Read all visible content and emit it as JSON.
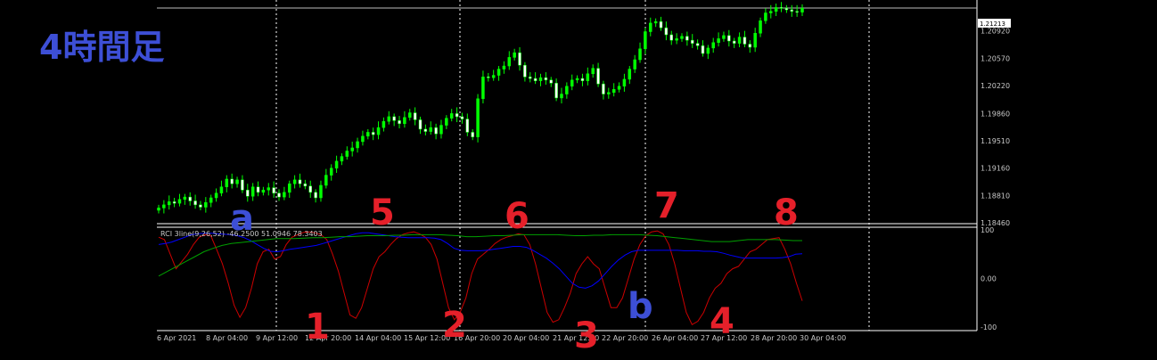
{
  "title": "4時間足",
  "indicator_label": "RCI 3line(9,26,52) -46.2500 51.0946 78.3403",
  "current_price": "1.21213",
  "colors": {
    "bull": "#00ff00",
    "bear": "#ffffff",
    "rci_short": "#cc0000",
    "rci_mid": "#0000ff",
    "rci_long": "#00a000",
    "annotation_red": "#e5202a",
    "annotation_blue": "#3d4fd6",
    "grid": "#ffffff"
  },
  "chart_data": [
    {
      "type": "candlestick",
      "title": "",
      "x_tick_labels": [
        "6 Apr 2021",
        "8 Apr 04:00",
        "9 Apr 12:00",
        "12 Apr 20:00",
        "14 Apr 04:00",
        "15 Apr 12:00",
        "16 Apr 20:00",
        "20 Apr 04:00",
        "21 Apr 12:00",
        "22 Apr 20:00",
        "26 Apr 04:00",
        "27 Apr 12:00",
        "28 Apr 20:00",
        "30 Apr 04:00"
      ],
      "y_tick_labels": [
        "1.20920",
        "1.20570",
        "1.20220",
        "1.19860",
        "1.19510",
        "1.19160",
        "1.18810",
        "1.18460"
      ],
      "y_ticks": [
        1.2092,
        1.2057,
        1.2022,
        1.1986,
        1.1951,
        1.1916,
        1.1881,
        1.1846
      ],
      "ylim": [
        1.1846,
        1.2127
      ],
      "horizontal_line": 1.21213,
      "closes": [
        1.1865,
        1.1869,
        1.1873,
        1.1871,
        1.1876,
        1.1879,
        1.1874,
        1.1869,
        1.1866,
        1.1872,
        1.1878,
        1.1884,
        1.1892,
        1.1902,
        1.1896,
        1.1901,
        1.1888,
        1.188,
        1.1892,
        1.1885,
        1.1888,
        1.1891,
        1.1884,
        1.1879,
        1.1885,
        1.1896,
        1.1901,
        1.1896,
        1.1893,
        1.1885,
        1.1878,
        1.1894,
        1.1907,
        1.1916,
        1.1925,
        1.1931,
        1.1938,
        1.1942,
        1.195,
        1.1957,
        1.1962,
        1.1959,
        1.1968,
        1.1976,
        1.1982,
        1.1977,
        1.1973,
        1.1981,
        1.1987,
        1.1978,
        1.1966,
        1.1963,
        1.1968,
        1.196,
        1.1971,
        1.198,
        1.1986,
        1.1982,
        1.1979,
        1.1962,
        1.1956,
        1.2005,
        1.2033,
        1.2032,
        1.2035,
        1.2043,
        1.2047,
        1.2058,
        1.2064,
        1.2048,
        1.2033,
        1.2031,
        1.2028,
        1.2032,
        1.2029,
        1.2025,
        1.2006,
        1.2011,
        1.2021,
        1.2029,
        1.2031,
        1.2028,
        1.2037,
        1.2044,
        1.2024,
        1.2011,
        1.2013,
        1.2017,
        1.2021,
        1.203,
        1.2043,
        1.2055,
        1.2069,
        1.2091,
        1.2102,
        1.2104,
        1.2096,
        1.2087,
        1.208,
        1.2082,
        1.2085,
        1.208,
        1.2076,
        1.2073,
        1.2063,
        1.207,
        1.2077,
        1.2082,
        1.2086,
        1.2079,
        1.2076,
        1.2084,
        1.2075,
        1.2071,
        1.2089,
        1.2105,
        1.2115,
        1.2117,
        1.2122,
        1.2121,
        1.2119,
        1.2117,
        1.2116,
        1.2121
      ]
    },
    {
      "type": "line",
      "title": "",
      "y_tick_labels": [
        "100",
        "0.00",
        "-100"
      ],
      "y_ticks": [
        100,
        0,
        -100
      ],
      "ylim": [
        -100,
        100
      ],
      "series": [
        {
          "color": "#cc0000",
          "values": [
            85,
            80,
            50,
            20,
            35,
            50,
            70,
            85,
            90,
            88,
            60,
            30,
            -10,
            -55,
            -80,
            -60,
            -20,
            30,
            55,
            60,
            40,
            45,
            70,
            85,
            90,
            95,
            96,
            94,
            90,
            80,
            50,
            15,
            -30,
            -75,
            -82,
            -60,
            -20,
            20,
            45,
            55,
            70,
            82,
            90,
            94,
            96,
            92,
            85,
            70,
            40,
            -10,
            -60,
            -85,
            -70,
            -40,
            10,
            40,
            50,
            60,
            72,
            80,
            85,
            88,
            92,
            90,
            70,
            30,
            -20,
            -70,
            -90,
            -85,
            -60,
            -30,
            10,
            30,
            45,
            30,
            20,
            -20,
            -60,
            -60,
            -40,
            0,
            40,
            70,
            88,
            96,
            98,
            92,
            70,
            30,
            -20,
            -70,
            -95,
            -88,
            -70,
            -40,
            -20,
            -10,
            10,
            20,
            25,
            40,
            55,
            60,
            70,
            80,
            82,
            84,
            60,
            30,
            -10,
            -46
          ]
        },
        {
          "color": "#0000ff",
          "values": [
            70,
            72,
            75,
            80,
            85,
            90,
            92,
            93,
            93,
            92,
            91,
            90,
            88,
            84,
            78,
            70,
            62,
            56,
            55,
            57,
            60,
            62,
            64,
            66,
            68,
            72,
            76,
            80,
            84,
            88,
            92,
            94,
            94,
            92,
            90,
            88,
            86,
            85,
            84,
            84,
            84,
            84,
            83,
            80,
            72,
            62,
            58,
            57,
            57,
            57,
            58,
            60,
            62,
            64,
            66,
            66,
            64,
            58,
            50,
            42,
            32,
            20,
            5,
            -10,
            -18,
            -20,
            -15,
            -5,
            10,
            25,
            38,
            48,
            55,
            58,
            58,
            58,
            58,
            58,
            58,
            58,
            57,
            57,
            57,
            56,
            56,
            55,
            52,
            48,
            45,
            42,
            42,
            42,
            42,
            42,
            42,
            43,
            45,
            50,
            51
          ]
        },
        {
          "color": "#00a000",
          "values": [
            5,
            15,
            25,
            35,
            45,
            55,
            62,
            68,
            72,
            74,
            76,
            78,
            80,
            82,
            82,
            82,
            83,
            84,
            84,
            85,
            86,
            86,
            87,
            88,
            88,
            88,
            89,
            89,
            90,
            90,
            90,
            90,
            89,
            88,
            86,
            86,
            87,
            88,
            88,
            89,
            90,
            90,
            90,
            90,
            90,
            89,
            88,
            88,
            89,
            89,
            90,
            90,
            90,
            90,
            89,
            88,
            86,
            84,
            82,
            80,
            78,
            76,
            76,
            76,
            78,
            80,
            80,
            80,
            80,
            79,
            78,
            78
          ]
        }
      ]
    }
  ],
  "annotations": {
    "top_numbers": [
      "5",
      "6",
      "7",
      "8"
    ],
    "bottom_numbers": [
      "1",
      "2",
      "3",
      "4"
    ],
    "letter_a": "a",
    "letter_b": "b"
  }
}
